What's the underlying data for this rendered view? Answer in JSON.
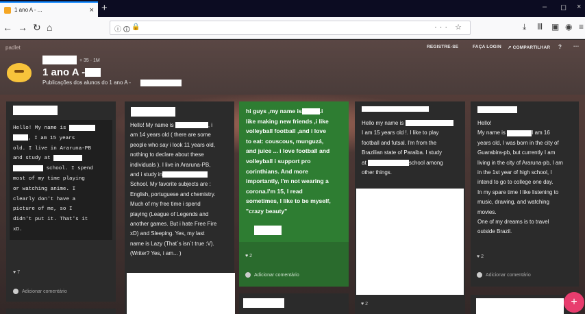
{
  "browser": {
    "tab_title": "1 ano A - ...",
    "tab_close": "×",
    "new_tab": "+",
    "win_min": "–",
    "win_max": "◻",
    "win_close": "×",
    "nav_back": "←",
    "nav_forward": "→",
    "nav_reload": "↻",
    "nav_home": "⌂",
    "url_info": "ⓘ 🛈",
    "url_lock": "🔒",
    "url_actions": "··· ☆",
    "toolbar_download": "⤓",
    "toolbar_library": "Ⅲ",
    "toolbar_sidebar": "▣",
    "toolbar_account": "◉",
    "toolbar_menu": "≡"
  },
  "padlet": {
    "logo": "padlet",
    "nav": {
      "register": "REGISTRE-SE",
      "login": "FAÇA LOGIN",
      "share": "↗ COMPARTILHAR",
      "help": "?",
      "more": "···"
    },
    "stats": "+ 35  ·  1M",
    "title": "1 ano A -",
    "subtitle": "Publicações dos alunos do 1 ano A -",
    "fab": "+"
  },
  "cards": [
    {
      "lines": [
        "Hello! My name is",
        ", I am 15 years",
        "old. I live in Araruna-PB",
        "and study at",
        "school. I spend",
        "most of my time playing",
        "or watching anime. I",
        "clearly don't have a",
        "picture of me, so I",
        "didn't put it. That's it",
        "xD."
      ],
      "likes": "♥ 7",
      "comment": "Adicionar comentário"
    },
    {
      "lines": [
        "Hello! My name is",
        ", i",
        "am 14 years old ( there are some",
        "people who say i look 11 years old,",
        "nothing to declare about these",
        "individuals ). I live in Araruna-PB,",
        "and i study in",
        "School. My favorite subjects are :",
        "English, portuguese and chemistry.",
        "Much of my free time i spend",
        "playing (League of Legends and",
        "another games. But i hate Free Fire",
        "xD) and Sleeping. Yes, my last",
        "name is Lazy (That´s isn´t true :V).",
        "(Writer? Yes, i am... )"
      ]
    },
    {
      "lines": [
        "hi guys ,my name is",
        ".i",
        "like making new friends ,i like",
        "volleyball football ,and i love",
        "to eat: couscous, munguzá,",
        "and juice ... i love football and",
        "volleyball i support pro",
        "corinthians. And more",
        "importantly, I'm not wearing a",
        "corona.I'm 15, I read",
        "sometimes, I like to be myself,",
        "\"crazy beauty\""
      ],
      "likes": "♥ 2",
      "comment": "Adicionar comentário"
    },
    {
      "lines": [
        "Hello my name is",
        "I am 15 years old !. I like to play",
        "football and futsal. I'm from the",
        "Brazilian state of Paraiba. I study",
        "at",
        "school among",
        "other things."
      ],
      "likes": "♥ 2"
    },
    {
      "lines": [
        "Hello!",
        "My name is",
        "I am 16",
        "years old, I was born in the city of",
        "Guarabira-pb, but currently I am",
        "living in the city of Araruna-pb, I am",
        "in the 1st year of high school, I",
        "intend to go to college one day.",
        "In my spare time I like listening to",
        "music, drawing, and watching",
        "movies.",
        "One of my dreams is to travel",
        "outside Brazil."
      ],
      "likes": "♥ 2",
      "comment": "Adicionar comentário"
    }
  ]
}
